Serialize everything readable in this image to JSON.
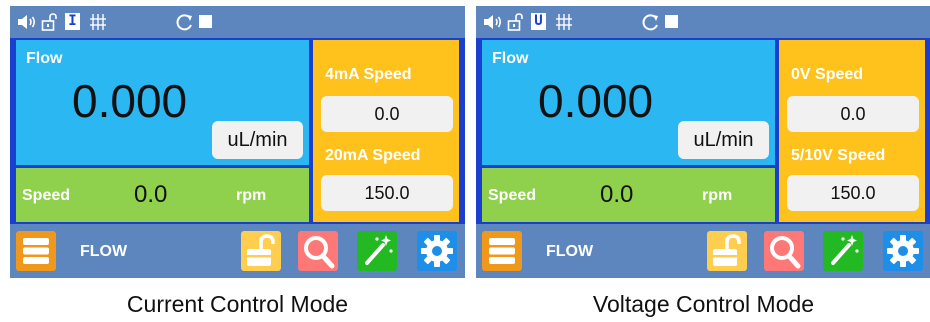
{
  "panels": [
    {
      "status_mode_letter": "I",
      "flow_label": "Flow",
      "flow_value": "0.000",
      "flow_unit": "uL/min",
      "speed_label": "Speed",
      "speed_value": "0.0",
      "speed_unit": "rpm",
      "low_label": "4mA Speed",
      "low_value": "0.0",
      "high_label": "20mA Speed",
      "high_value": "150.0",
      "bottom_label": "FLOW",
      "caption": "Current Control Mode"
    },
    {
      "status_mode_letter": "U",
      "flow_label": "Flow",
      "flow_value": "0.000",
      "flow_unit": "uL/min",
      "speed_label": "Speed",
      "speed_value": "0.0",
      "speed_unit": "rpm",
      "low_label": "0V Speed",
      "low_value": "0.0",
      "high_label": "5/10V Speed",
      "high_value": "150.0",
      "bottom_label": "FLOW",
      "caption": "Voltage Control Mode"
    }
  ],
  "icons": [
    "speaker-icon",
    "unlock-icon",
    "mode-letter-icon",
    "flow-channels-icon",
    "refresh-icon",
    "stop-icon",
    "menu-icon",
    "unlock-button-icon",
    "search-icon",
    "wand-icon",
    "gear-icon"
  ],
  "colors": {
    "screen_background": "#1a3fcf",
    "status_bar": "#5c86bd",
    "flow_box": "#2bb7f1",
    "speed_box": "#8fd04d",
    "analog_box": "#ffc21d",
    "menu_button": "#f0981c",
    "unlock_button": "#ffce4f",
    "search_button": "#ff7878",
    "wand_button": "#22b922",
    "gear_button": "#1e8fe8"
  }
}
